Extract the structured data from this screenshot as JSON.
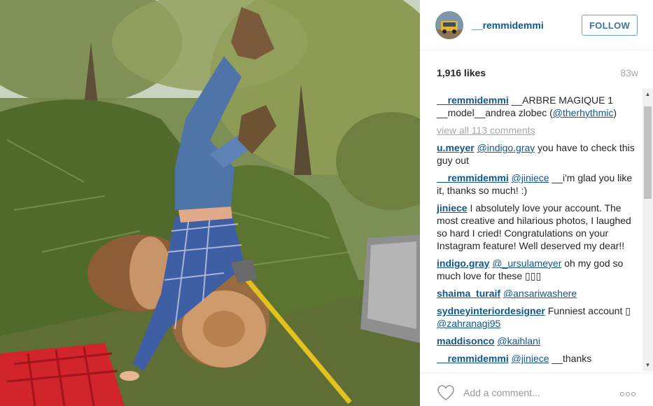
{
  "post": {
    "image_alt": "Person upside down diving head-first into a pile of pine branches and logs, legs in jeans in the air, axe beside them"
  },
  "header": {
    "username": "__remmidemmi",
    "follow_label": "FOLLOW"
  },
  "meta": {
    "likes": "1,916 likes",
    "age": "83w"
  },
  "caption": {
    "user": "__remmidemmi",
    "text_1": " __ARBRE MAGIQUE 1 __model__andrea zlobec (",
    "mention": "@therhythmic",
    "text_2": ")"
  },
  "view_all": "view all 113 comments",
  "comments": [
    {
      "user": "u.meyer",
      "mention": "@indigo.gray",
      "text": " you have to check this guy out"
    },
    {
      "user": "__remmidemmi",
      "mention": "@jiniece",
      "text": " __i'm glad you like it, thanks so much! :)"
    },
    {
      "user": "jiniece",
      "mention": "",
      "text": " I absolutely love your account. The most creative and hilarious photos, I laughed so hard I cried! Congratulations on your Instagram feature! Well deserved my dear!!"
    },
    {
      "user": "indigo.gray",
      "mention": "@_ursulameyer",
      "text": " oh my god so much love for these ▯▯▯"
    },
    {
      "user": "shaima_turaif",
      "mention": "@ansariwashere",
      "text": ""
    },
    {
      "user": "sydneyinteriordesigner",
      "mention": "",
      "text": " Funniest account ▯ ",
      "mention_after": "@zahranagi95"
    },
    {
      "user": "maddisonco",
      "mention": "@kaihlani",
      "text": ""
    },
    {
      "user": "__remmidemmi",
      "mention": "@jiniece",
      "text": " __thanks"
    }
  ],
  "footer": {
    "add_comment_placeholder": "Add a comment..."
  },
  "icons": {
    "heart": "heart-icon",
    "more": "more-options-icon",
    "scroll_up": "scroll-up-arrow-icon",
    "scroll_down": "scroll-down-arrow-icon"
  },
  "colors": {
    "link": "#125688",
    "follow_border": "#70a0c9",
    "muted": "#a5a7aa"
  }
}
